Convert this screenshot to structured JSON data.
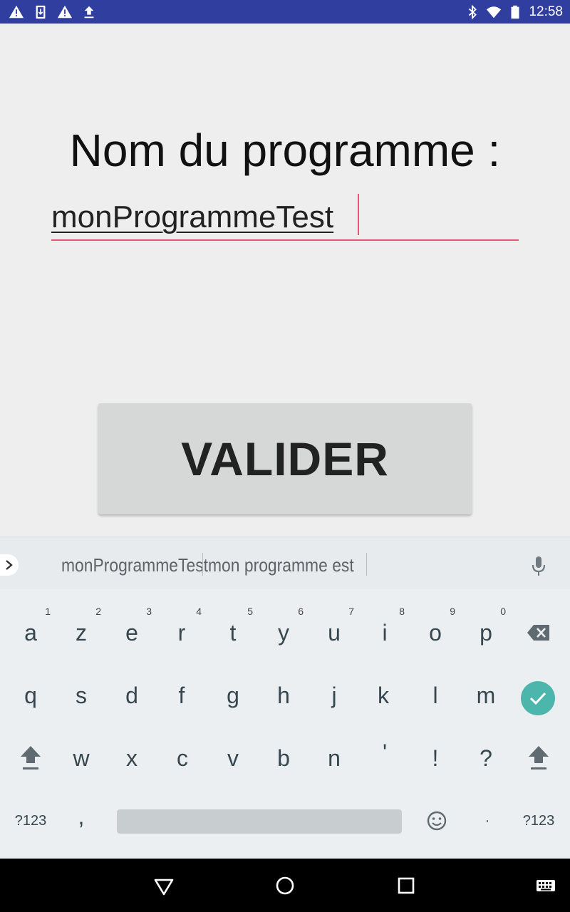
{
  "status_bar": {
    "time": "12:58",
    "left_icons": [
      "warning-icon",
      "download-icon",
      "warning-icon",
      "upload-icon"
    ],
    "right_icons": [
      "bluetooth-icon",
      "wifi-icon",
      "battery-icon"
    ],
    "background": "#303f9f"
  },
  "screen": {
    "title": "Nom du programme :",
    "input_value": "monProgrammeTest",
    "accent": "#e8537a",
    "button_label": "VALIDER"
  },
  "keyboard": {
    "suggestions": [
      "monProgrammeTest",
      "mon programme est"
    ],
    "row1": [
      {
        "label": "a",
        "hint": "1"
      },
      {
        "label": "z",
        "hint": "2"
      },
      {
        "label": "e",
        "hint": "3"
      },
      {
        "label": "r",
        "hint": "4"
      },
      {
        "label": "t",
        "hint": "5"
      },
      {
        "label": "y",
        "hint": "6"
      },
      {
        "label": "u",
        "hint": "7"
      },
      {
        "label": "i",
        "hint": "8"
      },
      {
        "label": "o",
        "hint": "9"
      },
      {
        "label": "p",
        "hint": "0"
      }
    ],
    "row2": [
      "q",
      "s",
      "d",
      "f",
      "g",
      "h",
      "j",
      "k",
      "l",
      "m"
    ],
    "row3": [
      "w",
      "x",
      "c",
      "v",
      "b",
      "n",
      "'",
      "!",
      "?"
    ],
    "row4": {
      "symbols_left": "?123",
      "comma": ",",
      "emoji_icon": "emoji-icon",
      "period": "·",
      "symbols_right": "?123"
    },
    "enter_color": "#4db6ac"
  },
  "nav_bar": {
    "buttons": [
      "back-icon",
      "home-icon",
      "recents-icon",
      "keyboard-icon"
    ]
  }
}
